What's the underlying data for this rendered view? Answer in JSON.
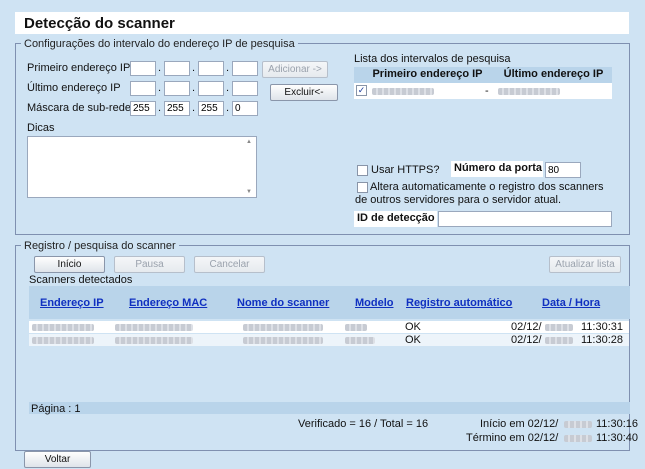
{
  "title": "Detecção do scanner",
  "ip_config": {
    "legend": "Configurações do intervalo do endereço IP de pesquisa",
    "first_ip_label": "Primeiro endereço IP",
    "last_ip_label": "Último endereço IP",
    "subnet_label": "Máscara de sub-rede",
    "subnet": [
      "255",
      "255",
      "255",
      "0"
    ],
    "add_button": "Adicionar ->",
    "delete_button": "Excluir<-",
    "hints_label": "Dicas"
  },
  "range_list": {
    "label": "Lista dos intervalos de pesquisa",
    "col_first": "Primeiro endereço IP",
    "col_last": "Último endereço IP",
    "separator": "-"
  },
  "options": {
    "https_label": "Usar HTTPS?",
    "port_label": "Número da porta",
    "port_value": "80",
    "auto_change_label": "Altera automaticamente o registro dos scanners de outros servidores para o servidor atual.",
    "detect_id_label": "ID de detecção",
    "detect_id_value": ""
  },
  "registry": {
    "legend": "Registro / pesquisa do scanner",
    "start_button": "Início",
    "pause_button": "Pausa",
    "cancel_button": "Cancelar",
    "refresh_button": "Atualizar lista",
    "detected_label": "Scanners detectados",
    "columns": [
      "Endereço IP",
      "Endereço MAC",
      "Nome do scanner",
      "Modelo",
      "Registro automático",
      "Data / Hora"
    ],
    "rows": [
      {
        "auto": "OK",
        "date": "02/12/",
        "time": "11:30:31"
      },
      {
        "auto": "OK",
        "date": "02/12/",
        "time": "11:30:28"
      }
    ],
    "page_label": "Página : 1",
    "verified_text": "Verificado = 16 / Total = 16",
    "start_text": "Início em 02/12/",
    "start_time": "11:30:16",
    "end_text": "Término em 02/12/",
    "end_time": "11:30:40"
  },
  "back_button": "Voltar"
}
